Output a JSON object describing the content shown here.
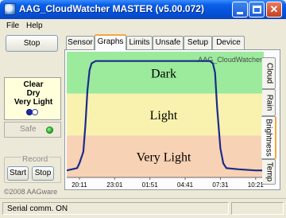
{
  "window": {
    "title": "AAG_CloudWatcher MASTER (v5.00.072)"
  },
  "menu": {
    "file": "File",
    "help": "Help"
  },
  "left_panel": {
    "stop_label": "Stop",
    "status": {
      "clear": "Clear",
      "dry": "Dry",
      "light": "Very Light"
    },
    "safe_label": "Safe",
    "safe_color": "#1CA81C",
    "record_label": "Record",
    "start_label": "Start",
    "stop_label2": "Stop",
    "copyright": "©2008 AAGware"
  },
  "tabs": [
    {
      "label": "Sensor",
      "active": false
    },
    {
      "label": "Graphs",
      "active": true
    },
    {
      "label": "Limits",
      "active": false
    },
    {
      "label": "Unsafe",
      "active": false
    },
    {
      "label": "Setup",
      "active": false
    },
    {
      "label": "Device",
      "active": false
    }
  ],
  "side_tabs": [
    {
      "label": "Cloud",
      "active": false
    },
    {
      "label": "Rain",
      "active": false
    },
    {
      "label": "Brightness",
      "active": true
    },
    {
      "label": "Temp",
      "active": false
    }
  ],
  "chart_data": {
    "type": "line",
    "watermark": "AAG_CloudWatcher",
    "zones": [
      {
        "label": "Dark",
        "color": "#9CEA9C"
      },
      {
        "label": "Light",
        "color": "#F8F2AE"
      },
      {
        "label": "Very Light",
        "color": "#F8D2B4"
      }
    ],
    "x_ticks": [
      "20:11",
      "23:01",
      "01:51",
      "04:41",
      "07:31",
      "10:21"
    ],
    "line_color": "#1A2C8C",
    "series": [
      {
        "x": [
          "19:10",
          "20:00",
          "20:11",
          "20:30",
          "20:40",
          "20:50",
          "21:00",
          "21:10",
          "21:30",
          "21:50",
          "22:30",
          "04:41",
          "06:00",
          "06:40",
          "06:55",
          "07:05",
          "07:15",
          "07:31",
          "07:45",
          "08:00",
          "09:00",
          "10:21",
          "11:00"
        ],
        "y": [
          6,
          8,
          12,
          22,
          45,
          75,
          92,
          98,
          100,
          100,
          100,
          100,
          100,
          100,
          98,
          90,
          60,
          25,
          12,
          8,
          7,
          6,
          6
        ]
      }
    ],
    "ylim": [
      0,
      108
    ]
  },
  "statusbar": {
    "text": "Serial comm. ON"
  }
}
